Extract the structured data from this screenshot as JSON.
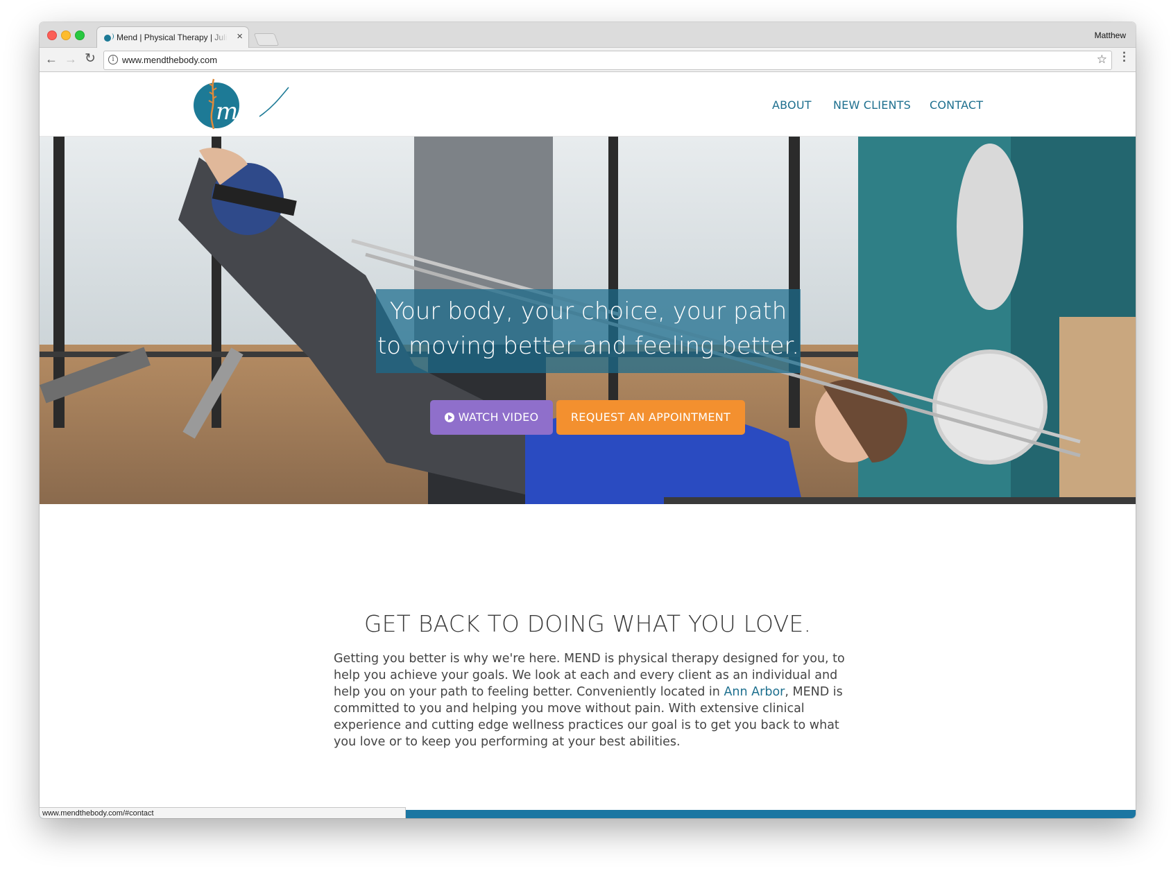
{
  "browser": {
    "tab_title": "Mend | Physical Therapy | Julie",
    "tab_close": "×",
    "profile_name": "Matthew",
    "url": "www.mendthebody.com",
    "status_url": "www.mendthebody.com/#contact"
  },
  "site": {
    "logo_text": "mend",
    "nav": {
      "about": "ABOUT",
      "new_clients": "NEW CLIENTS",
      "contact": "CONTACT"
    },
    "hero": {
      "tagline_line1": "Your body, your choice, your path",
      "tagline_line2": "to moving better and feeling better.",
      "watch_video": "WATCH VIDEO",
      "request_appointment": "REQUEST AN APPOINTMENT"
    },
    "section": {
      "heading": "GET BACK TO DOING WHAT YOU LOVE.",
      "paragraph_before_link": "Getting you better is why we're here. MEND is physical therapy designed for you, to help you achieve your goals. We look at each and every client as an individual and help you on your path to feeling better. Conveniently located in ",
      "link_text": "Ann Arbor",
      "paragraph_after_link": ", MEND is committed to you and helping you move without pain. With extensive clinical experience and cutting edge wellness practices our goal is to get you back to what you love or to keep you performing at your best abilities."
    }
  },
  "colors": {
    "brand_teal": "#1d6f8e",
    "video_button": "#8f6fcb",
    "appointment_button": "#f3902f",
    "bottom_bar": "#1b76a2"
  }
}
